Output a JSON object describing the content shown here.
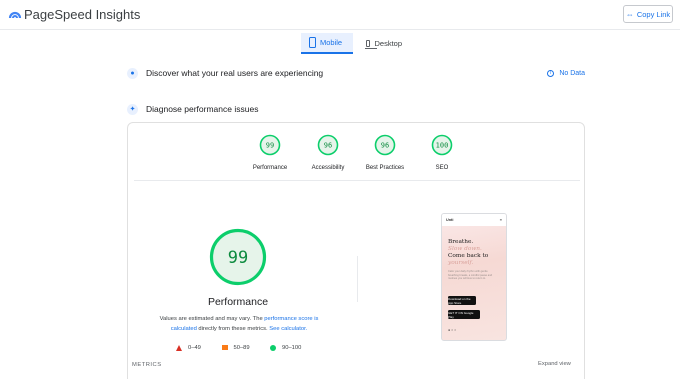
{
  "header": {
    "title": "PageSpeed Insights",
    "copy_link": "Copy Link",
    "link_icon": "⇔"
  },
  "tabs": [
    {
      "label": "Mobile",
      "active": true
    },
    {
      "label": "Desktop",
      "active": false
    }
  ],
  "discover": {
    "title": "Discover what your real users are experiencing",
    "status": "No Data"
  },
  "diagnose": {
    "title": "Diagnose performance issues"
  },
  "scores": [
    {
      "value": 99,
      "label": "Performance"
    },
    {
      "value": 96,
      "label": "Accessibility"
    },
    {
      "value": 96,
      "label": "Best Practices"
    },
    {
      "value": 100,
      "label": "SEO"
    }
  ],
  "performance": {
    "score": 99,
    "title": "Performance",
    "note_pre": "Values are estimated and may vary. The ",
    "note_link1": "performance score is calculated",
    "note_mid": " directly from these metrics. ",
    "note_link2": "See calculator."
  },
  "legend": [
    {
      "range": "0–49",
      "color": "#d93025"
    },
    {
      "range": "50–89",
      "color": "#fa7b17"
    },
    {
      "range": "90–100",
      "color": "#0cce6b"
    }
  ],
  "metrics": {
    "label": "METRICS",
    "expand": "Expand view"
  },
  "phone": {
    "brand": "Unti",
    "menu": "≡",
    "headline_1": "Breathe.",
    "headline_2": "Slow down.",
    "headline_3": "Come back to",
    "headline_4": "yourself.",
    "body": "Calm your daily rhythm with gentle breathing breaks, a mindful pause and routines you will love to return to.",
    "app_store": "Download on the App Store",
    "google_play": "GET IT ON Google Play",
    "dots": "● ○ ○"
  },
  "colors": {
    "good": "#0cce6b",
    "good_text": "#0c8a3e",
    "accent": "#1a73e8"
  }
}
